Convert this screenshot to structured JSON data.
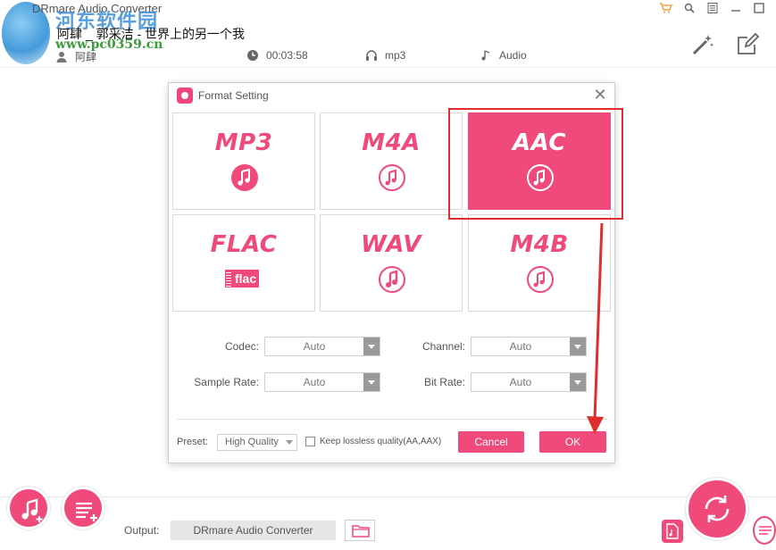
{
  "app": {
    "title": "DRmare Audio Converter"
  },
  "watermark": {
    "name": "河东软件园",
    "url": "www.pc0359.cn"
  },
  "track": {
    "title": "阿肆 _ 郭采洁 - 世界上的另一个我",
    "artist": "阿肆",
    "duration": "00:03:58",
    "format": "mp3",
    "type": "Audio"
  },
  "icons": {
    "toolbar": [
      "cart-icon",
      "search-icon",
      "menu-icon",
      "minimize-icon",
      "maximize-icon"
    ],
    "edit": [
      "effects-wand-icon",
      "edit-icon"
    ]
  },
  "dialog": {
    "title": "Format Setting",
    "formats": [
      {
        "name": "MP3",
        "selected": false
      },
      {
        "name": "M4A",
        "selected": false
      },
      {
        "name": "AAC",
        "selected": true
      },
      {
        "name": "FLAC",
        "selected": false
      },
      {
        "name": "WAV",
        "selected": false
      },
      {
        "name": "M4B",
        "selected": false
      }
    ],
    "flac_badge": "flac",
    "options": {
      "codec_label": "Codec:",
      "codec_value": "Auto",
      "channel_label": "Channel:",
      "channel_value": "Auto",
      "sample_rate_label": "Sample Rate:",
      "sample_rate_value": "Auto",
      "bit_rate_label": "Bit Rate:",
      "bit_rate_value": "Auto"
    },
    "preset_label": "Preset:",
    "preset_value": "High Quality",
    "lossless_label": "Keep lossless quality(AA,AAX)",
    "lossless_checked": false,
    "cancel_label": "Cancel",
    "ok_label": "OK"
  },
  "bottom": {
    "output_label": "Output:",
    "output_path": "DRmare Audio Converter"
  },
  "colors": {
    "accent": "#f04a7a",
    "annotation": "#e02d2d"
  }
}
